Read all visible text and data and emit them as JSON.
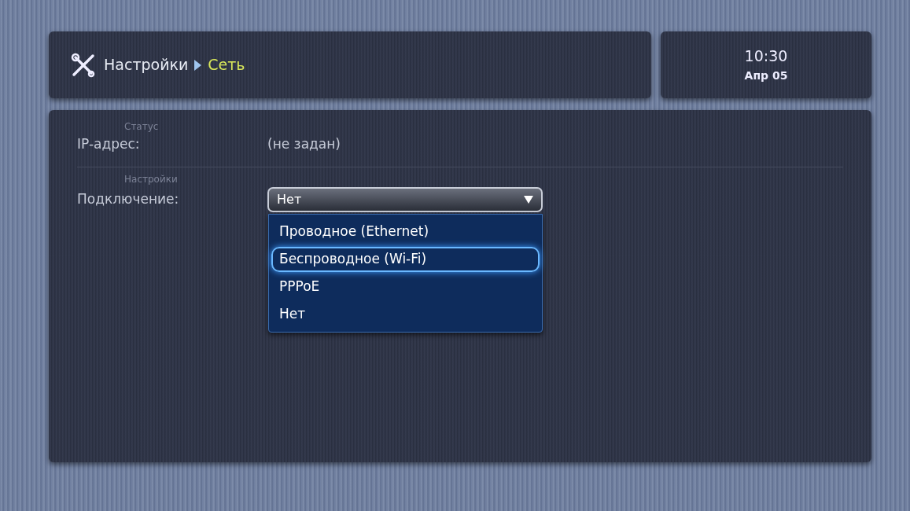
{
  "breadcrumb": {
    "parent": "Настройки",
    "current": "Сеть"
  },
  "clock": {
    "time": "10:30",
    "date": "Апр 05"
  },
  "status_group": {
    "legend": "Статус",
    "rows": [
      {
        "label": "IP-адрес:",
        "value": "(не задан)"
      }
    ]
  },
  "settings_group": {
    "legend": "Настройки",
    "connection": {
      "label": "Подключение:",
      "value": "Нет",
      "expanded": true,
      "options": [
        {
          "label": "Проводное (Ethernet)",
          "highlighted": false
        },
        {
          "label": "Беспроводное (Wi-Fi)",
          "highlighted": true
        },
        {
          "label": "PPPoE",
          "highlighted": false
        },
        {
          "label": "Нет",
          "highlighted": false
        }
      ]
    }
  }
}
